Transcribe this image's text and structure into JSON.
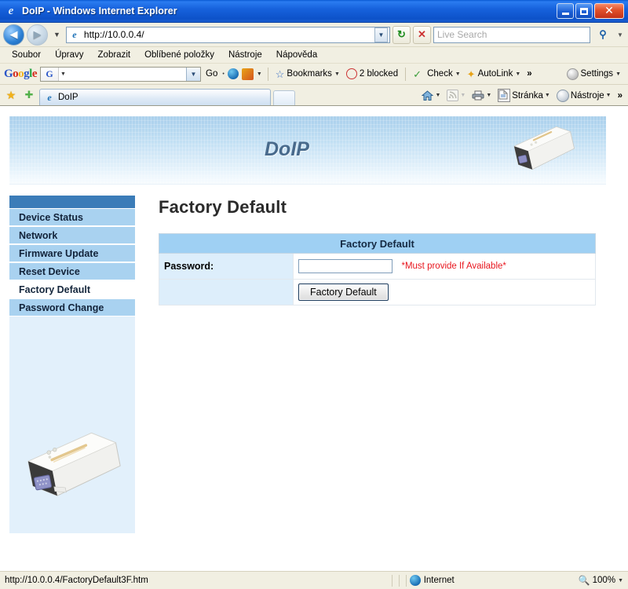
{
  "window": {
    "title": "DoIP - Windows Internet Explorer",
    "icon": "ie-icon",
    "minimize_label": "",
    "maximize_label": "",
    "close_label": "✕"
  },
  "address_bar": {
    "back_label": "◀",
    "forward_label": "▶",
    "history_caret": "▼",
    "url": "http://10.0.0.4/",
    "url_dropdown_caret": "▼",
    "refresh_label": "↻",
    "stop_label": "✕",
    "search_placeholder": "Live Search",
    "search_value": "",
    "search_go_label": "⚲",
    "search_caret": "▼"
  },
  "menu": {
    "items": [
      {
        "label": "Soubor"
      },
      {
        "label": "Úpravy"
      },
      {
        "label": "Zobrazit"
      },
      {
        "label": "Oblíbené položky"
      },
      {
        "label": "Nástroje"
      },
      {
        "label": "Nápověda"
      }
    ]
  },
  "google_toolbar": {
    "logo": "Google",
    "logo_letters": [
      "G",
      "o",
      "o",
      "g",
      "l",
      "e"
    ],
    "search_value": "",
    "search_prefix": "G",
    "search_prefix_caret": "▼",
    "go_label": "Go",
    "items": [
      {
        "label": "Bookmarks",
        "icon": "star-icon",
        "caret": "▼"
      },
      {
        "label": "2 blocked",
        "icon": "blocked-icon",
        "caret": ""
      },
      {
        "label": "Check",
        "icon": "spellcheck-icon",
        "caret": "▼"
      },
      {
        "label": "AutoLink",
        "icon": "autolink-icon",
        "caret": "▼"
      },
      {
        "label": "»",
        "icon": "more-icon",
        "caret": ""
      }
    ],
    "settings_label": "Settings",
    "settings_caret": "▼"
  },
  "tab_bar": {
    "favorites_icon": "star-icon",
    "add_favorites_icon": "add-favorite-icon",
    "tabs": [
      {
        "label": "DoIP",
        "icon": "ie-icon",
        "active": true
      }
    ],
    "new_tab_label": "",
    "tools": [
      {
        "label": "",
        "icon": "home-icon",
        "caret": "▼"
      },
      {
        "label": "",
        "icon": "rss-icon",
        "caret": "▼"
      },
      {
        "label": "",
        "icon": "print-icon",
        "caret": "▼"
      },
      {
        "label": "Stránka",
        "icon": "page-icon",
        "caret": "▼"
      },
      {
        "label": "Nástroje",
        "icon": "gear-icon",
        "caret": "▼"
      }
    ],
    "overflow_label": "»"
  },
  "page": {
    "banner_title": "DoIP",
    "banner_device_icon": "device-image",
    "sidebar": {
      "items": [
        {
          "label": "Device Status",
          "active": false
        },
        {
          "label": "Network",
          "active": false
        },
        {
          "label": "Firmware Update",
          "active": false
        },
        {
          "label": "Reset Device",
          "active": false
        },
        {
          "label": "Factory Default",
          "active": true
        },
        {
          "label": "Password Change",
          "active": false
        }
      ],
      "device_icon": "device-image"
    },
    "main": {
      "heading": "Factory Default",
      "table_header": "Factory Default",
      "password_label": "Password:",
      "password_value": "",
      "password_note": "*Must provide If Available*",
      "submit_label": "Factory Default"
    }
  },
  "status_bar": {
    "url": "http://10.0.0.4/FactoryDefault3F.htm",
    "zone_label": "Internet",
    "zone_icon": "globe-icon",
    "zoom_label": "100%",
    "zoom_icon": "magnifier-icon",
    "zoom_caret": "▼"
  },
  "colors": {
    "titlebar_blue": "#1762dd",
    "sidebar_item_blue": "#a9d2f0",
    "sidebar_top_blue": "#3b7cb8",
    "table_header_blue": "#9fd0f3",
    "note_red": "#e8171f",
    "banner_text": "#486a8c"
  }
}
